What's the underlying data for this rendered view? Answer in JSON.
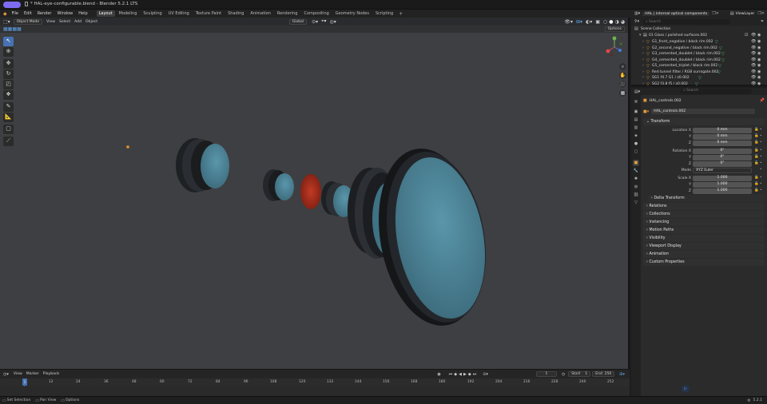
{
  "window": {
    "title": "* HAL-eye-configurable.blend - Blender 5.2.1 LTS",
    "version": "5.2.1"
  },
  "menu": [
    "File",
    "Edit",
    "Render",
    "Window",
    "Help"
  ],
  "workspaces": {
    "active": "Layout",
    "tabs": [
      "Layout",
      "Modeling",
      "Sculpting",
      "UV Editing",
      "Texture Paint",
      "Shading",
      "Animation",
      "Rendering",
      "Compositing",
      "Geometry Nodes",
      "Scripting"
    ]
  },
  "viewport_header": {
    "mode": "Object Mode",
    "menus": [
      "View",
      "Select",
      "Add",
      "Object"
    ],
    "transform_orientation": "Global",
    "options_label": "Options"
  },
  "scene": {
    "name": "HAL | internal optical components",
    "view_layer": "ViewLayer"
  },
  "outliner": {
    "search_placeholder": "Search",
    "root": "Scene Collection",
    "items": [
      "01 Glass / polished surfaces.002",
      "G1_front_negative / black rim.002",
      "G2_second_negative / black rim.002",
      "G3_cemented_doublet / black rim.002",
      "G4_cemented_doublet / black rim.002",
      "G5_cemented_triplet / black rim.002",
      "Red tunnel filter / RGB surrogate.002",
      "SG1 f4.7 G1 / z0.002",
      "SG2 f3.8 f5 / z0.002"
    ]
  },
  "properties": {
    "search_placeholder": "Search",
    "object_name": "HAL_controls.002",
    "data_name": "HAL_controls.002",
    "transform": {
      "header": "Transform",
      "location_label": "Location X",
      "location": [
        "0 mm",
        "0 mm",
        "0 mm"
      ],
      "rotation_label": "Rotation X",
      "rotation": [
        "0°",
        "0°",
        "0°"
      ],
      "mode_label": "Mode",
      "mode": "XYZ Euler",
      "scale_label": "Scale X",
      "scale": [
        "1.000",
        "1.000",
        "1.000"
      ],
      "axis_y": "Y",
      "axis_z": "Z"
    },
    "subpanels": [
      "Delta Transform"
    ],
    "panels": [
      "Relations",
      "Collections",
      "Instancing",
      "Motion Paths",
      "Visibility",
      "Viewport Display",
      "Animation",
      "Custom Properties"
    ]
  },
  "timeline": {
    "menus": [
      "View",
      "Marker",
      "Playback"
    ],
    "current_frame": "1",
    "start_label": "Start",
    "start": "1",
    "end_label": "End",
    "end": "250",
    "ticks": [
      "1",
      "12",
      "24",
      "36",
      "48",
      "60",
      "72",
      "84",
      "96",
      "108",
      "120",
      "132",
      "144",
      "156",
      "168",
      "180",
      "192",
      "204",
      "216",
      "228",
      "240",
      "252"
    ]
  },
  "statusbar": {
    "items": [
      "Set Selection",
      "Pan View",
      "Options"
    ],
    "version": "5.2.1"
  },
  "colors": {
    "accent": "#4772b3",
    "lens_blue": "#4d8598",
    "filter_red": "#b0301e",
    "workspace_badge": "#7d6cf3"
  }
}
